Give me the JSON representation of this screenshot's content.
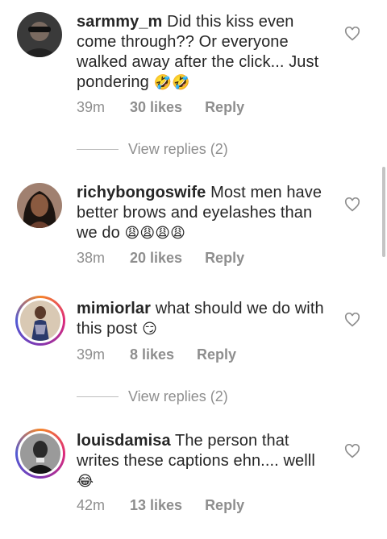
{
  "comments": [
    {
      "username": "sarmmy_m",
      "text": "Did this kiss even come through?? Or everyone walked away after the click... Just pondering",
      "emoji": "🤣🤣",
      "time": "39m",
      "likes": "30 likes",
      "reply": "Reply",
      "view_replies": "View replies (2)"
    },
    {
      "username": "richybongoswife",
      "text": "Most men have better brows and eyelashes than we do",
      "emoji": "😩😩😩😩",
      "time": "38m",
      "likes": "20 likes",
      "reply": "Reply"
    },
    {
      "username": "mimiorlar",
      "text": "what should we do with this post",
      "emoji": "😏",
      "time": "39m",
      "likes": "8 likes",
      "reply": "Reply",
      "view_replies": "View replies (2)"
    },
    {
      "username": "louisdamisa",
      "text": "The person that writes these captions ehn.... welll",
      "emoji": "😂",
      "time": "42m",
      "likes": "13 likes",
      "reply": "Reply"
    }
  ],
  "icons": {
    "like": "heart-outline-icon"
  },
  "colors": {
    "meta": "#8e8e8e",
    "text": "#262626",
    "heart": "#8e8e8e"
  }
}
